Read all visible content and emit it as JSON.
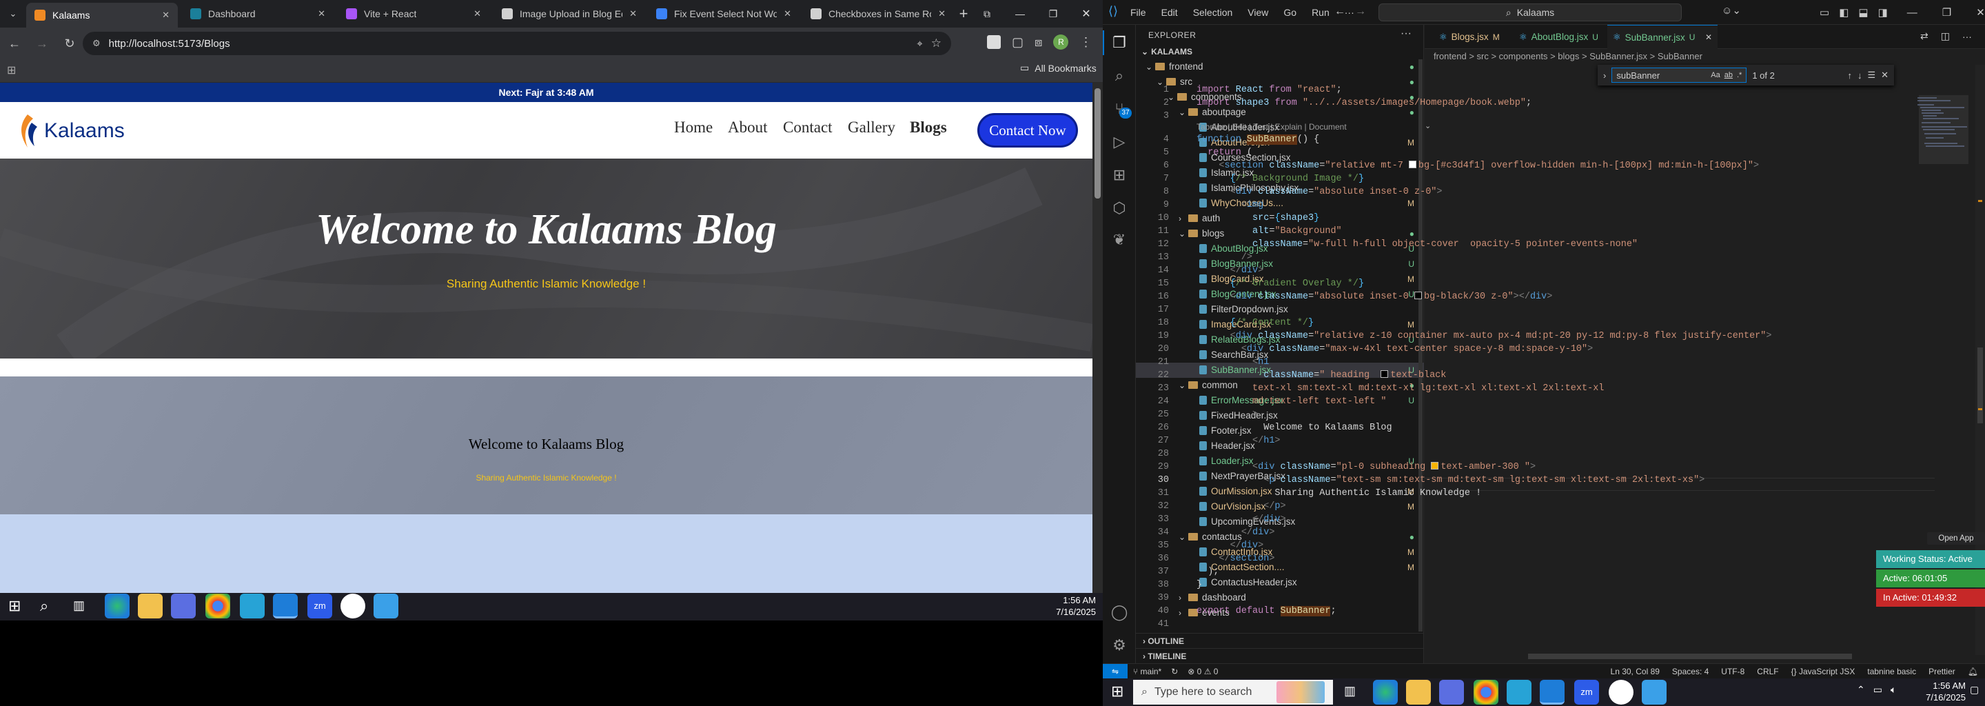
{
  "browser": {
    "tabs": [
      {
        "title": "Kalaams",
        "color": "#f08a24"
      },
      {
        "title": "Dashboard",
        "color": "#1b7f9a"
      },
      {
        "title": "Vite + React",
        "color": "#a855f7"
      },
      {
        "title": "Image Upload in Blog Editor",
        "color": "#d0d0d0"
      },
      {
        "title": "Fix Event Select Not Working",
        "color": "#3b82f6"
      },
      {
        "title": "Checkboxes in Same Row",
        "color": "#d0d0d0"
      }
    ],
    "url": "http://localhost:5173/Blogs",
    "bookmarks_label": "All Bookmarks",
    "profile_initial": "R"
  },
  "site": {
    "announcement": "Next: Fajr at 3:48 AM",
    "logo_text": "Kalaams",
    "nav": [
      "Home",
      "About",
      "Contact",
      "Gallery",
      "Blogs"
    ],
    "cta": "Contact Now",
    "hero_title": "Welcome to Kalaams Blog",
    "hero_subtitle": "Sharing Authentic Islamic Knowledge !",
    "banner_title": "Welcome to Kalaams Blog",
    "banner_subtitle": "Sharing Authentic Islamic Knowledge !"
  },
  "taskbar_left": {
    "time": "1:56 AM",
    "date": "7/16/2025"
  },
  "vscode": {
    "menu": [
      "File",
      "Edit",
      "Selection",
      "View",
      "Go",
      "Run",
      "···"
    ],
    "search_placeholder": "Kalaams",
    "explorer_title": "EXPLORER",
    "workspace": "KALAAMS",
    "tree": [
      {
        "label": "frontend",
        "type": "folder",
        "indent": 1,
        "badge": "●",
        "bcolor": "#73c991"
      },
      {
        "label": "src",
        "type": "folder",
        "indent": 2,
        "badge": "●",
        "bcolor": "#73c991"
      },
      {
        "label": "components",
        "type": "folder",
        "indent": 3,
        "badge": "●",
        "bcolor": "#73c991"
      },
      {
        "label": "aboutpage",
        "type": "folder",
        "indent": 4,
        "badge": "●",
        "bcolor": "#73c991"
      },
      {
        "label": "AboutHeader.jsx",
        "type": "file",
        "indent": 5,
        "badge": "",
        "bcolor": "#cccccc"
      },
      {
        "label": "AboutHero.jsx",
        "type": "file",
        "indent": 5,
        "badge": "M",
        "bcolor": "#e2c08d"
      },
      {
        "label": "CoursesSection.jsx",
        "type": "file",
        "indent": 5,
        "badge": "",
        "bcolor": "#cccccc"
      },
      {
        "label": "Islamic.jsx",
        "type": "file",
        "indent": 5,
        "badge": "",
        "bcolor": "#cccccc"
      },
      {
        "label": "IslamicPhilosophy.jsx",
        "type": "file",
        "indent": 5,
        "badge": "",
        "bcolor": "#cccccc"
      },
      {
        "label": "WhyChooseUs....",
        "type": "file",
        "indent": 5,
        "badge": "M",
        "bcolor": "#e2c08d"
      },
      {
        "label": "auth",
        "type": "folder-closed",
        "indent": 4,
        "badge": "",
        "bcolor": "#cccccc"
      },
      {
        "label": "blogs",
        "type": "folder",
        "indent": 4,
        "badge": "●",
        "bcolor": "#73c991"
      },
      {
        "label": "AboutBlog.jsx",
        "type": "file",
        "indent": 5,
        "badge": "U",
        "bcolor": "#73c991"
      },
      {
        "label": "BlogBanner.jsx",
        "type": "file",
        "indent": 5,
        "badge": "U",
        "bcolor": "#73c991"
      },
      {
        "label": "BlogCard.jsx",
        "type": "file",
        "indent": 5,
        "badge": "M",
        "bcolor": "#e2c08d"
      },
      {
        "label": "BlogContent.jsx",
        "type": "file",
        "indent": 5,
        "badge": "U",
        "bcolor": "#73c991"
      },
      {
        "label": "FilterDropdown.jsx",
        "type": "file",
        "indent": 5,
        "badge": "",
        "bcolor": "#cccccc"
      },
      {
        "label": "ImageCard.jsx",
        "type": "file",
        "indent": 5,
        "badge": "M",
        "bcolor": "#e2c08d"
      },
      {
        "label": "RelatedBlogs.jsx",
        "type": "file",
        "indent": 5,
        "badge": "U",
        "bcolor": "#73c991"
      },
      {
        "label": "SearchBar.jsx",
        "type": "file",
        "indent": 5,
        "badge": "",
        "bcolor": "#cccccc"
      },
      {
        "label": "SubBanner.jsx",
        "type": "file",
        "indent": 5,
        "badge": "U",
        "bcolor": "#73c991",
        "selected": true
      },
      {
        "label": "common",
        "type": "folder",
        "indent": 4,
        "badge": "●",
        "bcolor": "#73c991"
      },
      {
        "label": "ErrorMessage.jsx",
        "type": "file",
        "indent": 5,
        "badge": "U",
        "bcolor": "#73c991"
      },
      {
        "label": "FixedHeader.jsx",
        "type": "file",
        "indent": 5,
        "badge": "",
        "bcolor": "#cccccc"
      },
      {
        "label": "Footer.jsx",
        "type": "file",
        "indent": 5,
        "badge": "",
        "bcolor": "#cccccc"
      },
      {
        "label": "Header.jsx",
        "type": "file",
        "indent": 5,
        "badge": "",
        "bcolor": "#cccccc"
      },
      {
        "label": "Loader.jsx",
        "type": "file",
        "indent": 5,
        "badge": "U",
        "bcolor": "#73c991"
      },
      {
        "label": "NextPrayerBar.jsx",
        "type": "file",
        "indent": 5,
        "badge": "",
        "bcolor": "#cccccc"
      },
      {
        "label": "OurMission.jsx",
        "type": "file",
        "indent": 5,
        "badge": "M",
        "bcolor": "#e2c08d"
      },
      {
        "label": "OurVision.jsx",
        "type": "file",
        "indent": 5,
        "badge": "M",
        "bcolor": "#e2c08d"
      },
      {
        "label": "UpcomingEvents.jsx",
        "type": "file",
        "indent": 5,
        "badge": "",
        "bcolor": "#cccccc"
      },
      {
        "label": "contactus",
        "type": "folder",
        "indent": 4,
        "badge": "●",
        "bcolor": "#73c991"
      },
      {
        "label": "ContactInfo.jsx",
        "type": "file",
        "indent": 5,
        "badge": "M",
        "bcolor": "#e2c08d"
      },
      {
        "label": "ContactSection....",
        "type": "file",
        "indent": 5,
        "badge": "M",
        "bcolor": "#e2c08d"
      },
      {
        "label": "ContactusHeader.jsx",
        "type": "file",
        "indent": 5,
        "badge": "",
        "bcolor": "#cccccc"
      },
      {
        "label": "dashboard",
        "type": "folder-closed",
        "indent": 4,
        "badge": "",
        "bcolor": "#cccccc"
      },
      {
        "label": "events",
        "type": "folder-closed",
        "indent": 4,
        "badge": "",
        "bcolor": "#cccccc"
      }
    ],
    "outline": "OUTLINE",
    "timeline": "TIMELINE",
    "editor_tabs": [
      {
        "label": "Blogs.jsx",
        "badge": "M",
        "bcolor": "#e2c08d"
      },
      {
        "label": "AboutBlog.jsx",
        "badge": "U",
        "bcolor": "#73c991"
      },
      {
        "label": "SubBanner.jsx",
        "badge": "U",
        "bcolor": "#73c991",
        "active": true
      }
    ],
    "breadcrumb": "frontend > src > components > blogs > SubBanner.jsx > SubBanner",
    "find_value": "subBanner",
    "find_result": "1 of 2",
    "codelens": "Tabnine | Edit | Test | Explain | Document",
    "code_lines": [
      "<span class='k'>import</span> <span class='a'>React</span> <span class='k'>from</span> <span class='s'>\"react\"</span>;",
      "<span class='k'>import</span> <span class='a'>shape3</span> <span class='k'>from</span> <span class='s'>\"../../assets/images/Homepage/book.webp\"</span>;",
      "",
      "<span class='t'>function</span> <span class='f hl'>SubBanner</span>() {",
      "  <span class='k'>return</span> (",
      "    <span class='g'>&lt;</span><span class='t'>section</span> <span class='a'>className</span>=<span class='s'>\"relative mt-7 <i class='sw' style='background:#fff'></i>bg-[#c3d4f1] overflow-hidden min-h-[100px] md:min-h-[100px]\"</span><span class='g'>&gt;</span>",
      "      <span class='v'>{</span><span class='c'>/* Background Image */</span><span class='v'>}</span>",
      "      <span class='g'>&lt;</span><span class='t'>div</span> <span class='a'>className</span>=<span class='s'>\"absolute inset-0 z-0\"</span><span class='g'>&gt;</span>",
      "        <span class='g'>&lt;</span><span class='t'>img</span>",
      "          <span class='a'>src</span>=<span class='v'>{</span><span class='a'>shape3</span><span class='v'>}</span>",
      "          <span class='a'>alt</span>=<span class='s'>\"Background\"</span>",
      "          <span class='a'>className</span>=<span class='s'>\"w-full h-full object-cover  opacity-5 pointer-events-none\"</span>",
      "        <span class='g'>/&gt;</span>",
      "      <span class='g'>&lt;/</span><span class='t'>div</span><span class='g'>&gt;</span>",
      "      <span class='v'>{</span><span class='c'>/* Gradient Overlay */</span><span class='v'>}</span>",
      "      <span class='g'>&lt;</span><span class='t'>div</span> <span class='a'>className</span>=<span class='s'>\"absolute inset-0 <i class='sw' style='background:#000'></i>bg-black/30 z-0\"</span><span class='g'>&gt;&lt;/</span><span class='t'>div</span><span class='g'>&gt;</span>",
      "",
      "      <span class='v'>{</span><span class='c'>/* Content */</span><span class='v'>}</span>",
      "      <span class='g'>&lt;</span><span class='t'>div</span> <span class='a'>className</span>=<span class='s'>\"relative z-10 container mx-auto px-4 md:pt-20 py-12 md:py-8 flex justify-center\"</span><span class='g'>&gt;</span>",
      "        <span class='g'>&lt;</span><span class='t'>div</span> <span class='a'>className</span>=<span class='s'>\"max-w-4xl text-center space-y-8 md:space-y-10\"</span><span class='g'>&gt;</span>",
      "          <span class='g'>&lt;</span><span class='t'>h1</span>",
      "            <span class='a'>className</span>=<span class='s'>\" heading  <i class='sw' style='background:#000'></i>text-black</span>",
      "<span class='s'>          text-xl sm:text-xl md:text-xl lg:text-xl xl:text-xl 2xl:text-xl</span>",
      "<span class='s'>          md:text-left text-left \"</span>",
      "          <span class='g'>&gt;</span>",
      "            Welcome to Kalaams Blog",
      "          <span class='g'>&lt;/</span><span class='t'>h1</span><span class='g'>&gt;</span>",
      "",
      "          <span class='g'>&lt;</span><span class='t'>div</span> <span class='a'>className</span>=<span class='s'>\"pl-0 subheading <i class='sw' style='background:#f5b400'></i>text-amber-300 \"</span><span class='g'>&gt;</span>",
      "            <span class='g'>&lt;</span><span class='t'>p</span> <span class='a'>className</span>=<span class='s'>\"text-sm sm:text-sm md:text-sm lg:text-sm xl:text-sm 2xl:text-xs\"</span><span class='g'>&gt;</span>",
      "              Sharing Authentic Islamic Knowledge !",
      "            <span class='g'>&lt;/</span><span class='t'>p</span><span class='g'>&gt;</span>",
      "          <span class='g'>&lt;/</span><span class='t'>div</span><span class='g'>&gt;</span>",
      "        <span class='g'>&lt;/</span><span class='t'>div</span><span class='g'>&gt;</span>",
      "      <span class='g'>&lt;/</span><span class='t'>div</span><span class='g'>&gt;</span>",
      "    <span class='g'>&lt;/</span><span class='t'>section</span><span class='g'>&gt;</span>",
      "  );",
      "}",
      "",
      "<span class='k'>export</span> <span class='k'>default</span> <span class='f hl'>SubBanner</span>;",
      ""
    ],
    "current_line": 30,
    "open_app": "Open App",
    "working_status": "Working Status: Active",
    "active_time": "Active: 06:01:05",
    "inactive_time": "In Active: 01:49:32",
    "status_left": [
      "main*",
      "⊗ 0 ⚠ 0"
    ],
    "status_right": [
      "Ln 30, Col 89",
      "Spaces: 4",
      "UTF-8",
      "CRLF",
      "{} JavaScript JSX",
      "tabnine basic",
      "Prettier"
    ],
    "activity_badge": "37"
  },
  "taskbar_right": {
    "search_placeholder": "Type here to search",
    "time": "1:56 AM",
    "date": "7/16/2025"
  }
}
